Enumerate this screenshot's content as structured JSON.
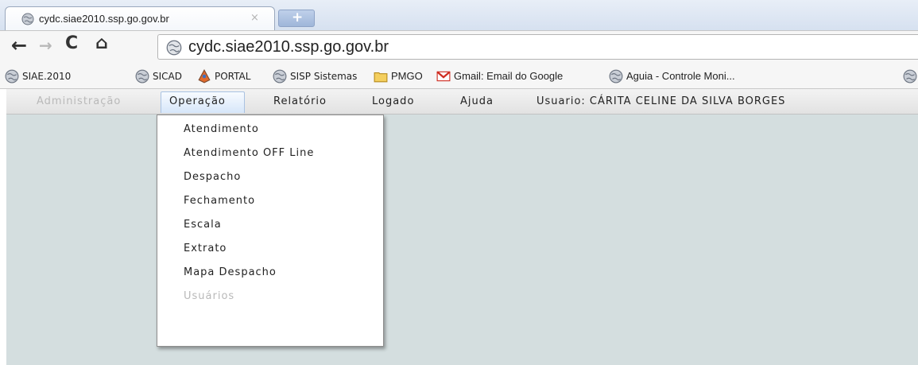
{
  "tab": {
    "title": "cydc.siae2010.ssp.go.gov.br",
    "close": "×",
    "new_tab": "+"
  },
  "toolbar": {
    "back": "←",
    "forward": "→",
    "reload": "C",
    "home": "⌂",
    "url": "cydc.siae2010.ssp.go.gov.br"
  },
  "bookmarks": [
    {
      "label": "SIAE.2010",
      "icon": "globe-icon"
    },
    {
      "label": "SICAD",
      "icon": "globe-icon"
    },
    {
      "label": "PORTAL",
      "icon": "portal-icon"
    },
    {
      "label": "SISP Sistemas",
      "icon": "globe-icon"
    },
    {
      "label": "PMGO",
      "icon": "folder-icon"
    },
    {
      "label": "Gmail: Email do Google",
      "icon": "gmail-icon"
    },
    {
      "label": "Aguia - Controle Moni...",
      "icon": "globe-icon"
    }
  ],
  "menu": {
    "items": [
      "Administração",
      "Operação",
      "Relatório",
      "Logado",
      "Ajuda"
    ],
    "user": "Usuario: CÁRITA CELINE DA SILVA BORGES"
  },
  "dropdown": {
    "items": [
      "Atendimento",
      "Atendimento OFF Line",
      "Despacho",
      "Fechamento",
      "Escala",
      "Extrato",
      "Mapa Despacho",
      "Usuários"
    ]
  },
  "colors": {
    "page_bg": "#d4dedf",
    "menu_active": "#d6e6f9",
    "disabled_text": "#b9b9b9"
  }
}
